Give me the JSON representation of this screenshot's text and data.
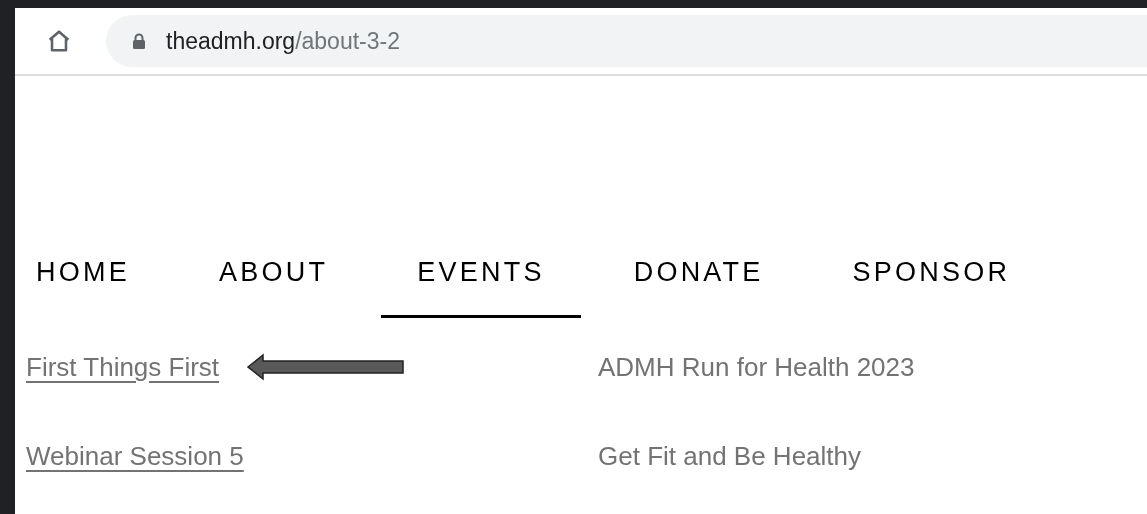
{
  "address_bar": {
    "domain": "theadmh.org",
    "path": "/about-3-2"
  },
  "nav": [
    {
      "label": "HOME",
      "selected": false
    },
    {
      "label": "ABOUT",
      "selected": false
    },
    {
      "label": "EVENTS",
      "selected": true
    },
    {
      "label": "DONATE",
      "selected": false
    },
    {
      "label": "SPONSOR",
      "selected": false
    }
  ],
  "events": [
    {
      "label": "First Things First",
      "underlined": true
    },
    {
      "label": "ADMH Run for Health 2023",
      "underlined": false
    },
    {
      "label": "Webinar Session 5",
      "underlined": true
    },
    {
      "label": "Get Fit and Be Healthy",
      "underlined": false
    }
  ]
}
